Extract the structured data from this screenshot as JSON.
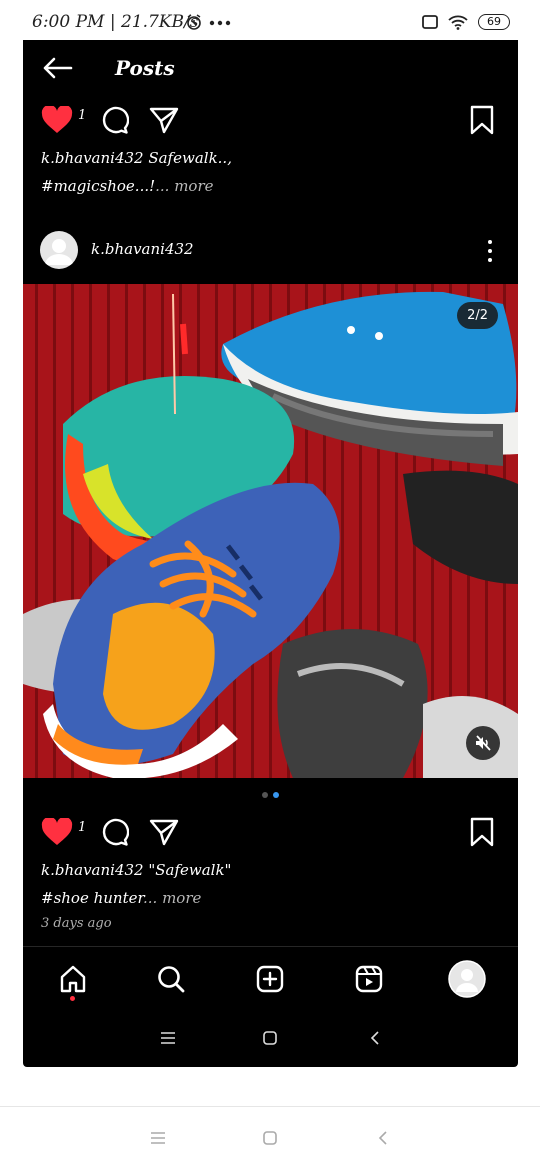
{
  "status_bar": {
    "time": "6:00 PM | 21.7KB/s",
    "battery": "69",
    "icons": [
      "alarm-icon",
      "more-dots-icon",
      "square-icon",
      "wifi-icon",
      "battery-icon"
    ]
  },
  "header": {
    "title": "Posts",
    "back_icon": "back-arrow-icon"
  },
  "post_prev": {
    "likes": "1",
    "caption_text": "k.bhavani432 Safewalk..,",
    "caption_line2": "#magicshoe...!",
    "more_label": "... more"
  },
  "post": {
    "username": "k.bhavani432",
    "media_counter": "2/2",
    "carousel": {
      "count": 2,
      "active_index": 1
    },
    "likes": "1",
    "caption_text": "k.bhavani432 \"Safewalk\"",
    "caption_line2": "#shoe hunter",
    "more_label": "... more",
    "time_ago": "3 days ago"
  },
  "bottom_nav": {
    "items": [
      "home-icon",
      "search-icon",
      "create-icon",
      "reels-icon",
      "profile-icon"
    ],
    "active": "home-icon"
  },
  "system_nav": [
    "menu-icon",
    "home-square-icon",
    "back-chevron-icon"
  ],
  "colors": {
    "heart": "#ff3040",
    "dot_active": "#3897f0",
    "background": "#000000"
  }
}
